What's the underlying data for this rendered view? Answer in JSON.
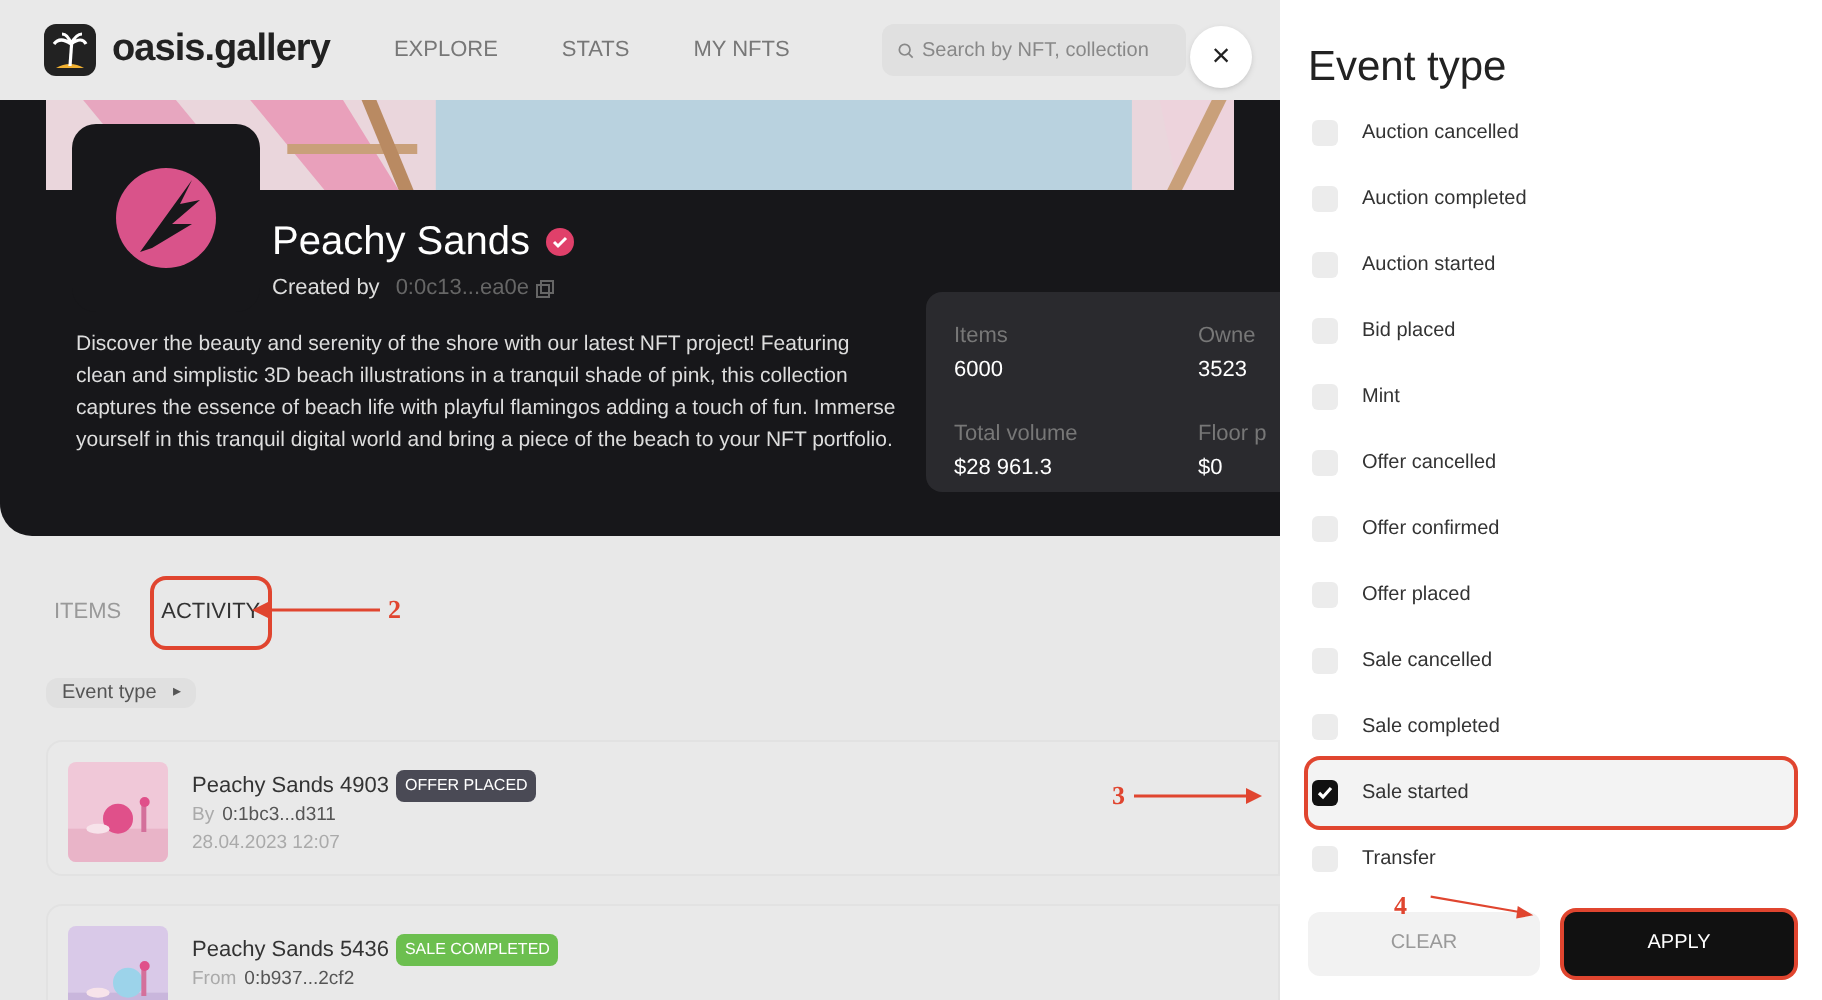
{
  "header": {
    "logo": "oasis.gallery",
    "nav": [
      {
        "label": "EXPLORE"
      },
      {
        "label": "STATS"
      },
      {
        "label": "MY NFTS"
      }
    ],
    "search": {
      "placeholder": "Search by NFT, collection"
    },
    "close": "×"
  },
  "banner": {
    "kind": "picture"
  },
  "collection": {
    "name": "Peachy Sands",
    "verified": true,
    "created_by_label": "Created by",
    "creator": "0:0c13...ea0e",
    "description": "Discover the beauty and serenity of the shore with our latest NFT project! Featuring clean and simplistic 3D beach illustrations in a tranquil shade of pink, this collection captures the essence of beach life with playful flamingos adding a touch of fun. Immerse yourself in this tranquil digital world and bring a piece of the beach to your NFT portfolio.",
    "stats": [
      {
        "label": "Items",
        "value": "6000"
      },
      {
        "label": "Owne",
        "value": "3523"
      },
      {
        "label": "Total volume",
        "value": "$28 961.3"
      },
      {
        "label": "Floor p",
        "value": "$0"
      }
    ]
  },
  "tabs": [
    {
      "label": "ITEMS",
      "selected": false,
      "highlighted": false
    },
    {
      "label": "ACTIVITY",
      "selected": true,
      "highlighted": true
    }
  ],
  "filter_button": {
    "label": "Event type",
    "arrow": "▸"
  },
  "activity": [
    {
      "title": "Peachy Sands 4903",
      "badge": "OFFER PLACED",
      "color": "#4a4a55",
      "by_label": "By",
      "address": "0:1bc3...d311",
      "date": "28.04.2023 12:07"
    },
    {
      "title": "Peachy Sands 5436",
      "badge": "SALE COMPLETED",
      "color": "#6cbf4f",
      "by_label": "From",
      "address": "0:b937...2cf2"
    }
  ],
  "drawer": {
    "title": "Event type",
    "options": [
      {
        "label": "Auction cancelled",
        "checked": false,
        "highlighted": false
      },
      {
        "label": "Auction completed",
        "checked": false,
        "highlighted": false
      },
      {
        "label": "Auction started",
        "checked": false,
        "highlighted": false
      },
      {
        "label": "Bid placed",
        "checked": false,
        "highlighted": false
      },
      {
        "label": "Mint",
        "checked": false,
        "highlighted": false
      },
      {
        "label": "Offer cancelled",
        "checked": false,
        "highlighted": false
      },
      {
        "label": "Offer confirmed",
        "checked": false,
        "highlighted": false
      },
      {
        "label": "Offer placed",
        "checked": false,
        "highlighted": false
      },
      {
        "label": "Sale cancelled",
        "checked": false,
        "highlighted": false
      },
      {
        "label": "Sale completed",
        "checked": false,
        "highlighted": false
      },
      {
        "label": "Sale started",
        "checked": true,
        "highlighted": true
      },
      {
        "label": "Transfer",
        "checked": false,
        "highlighted": false
      }
    ],
    "clear": {
      "label": "CLEAR",
      "highlighted": false
    },
    "apply": {
      "label": "APPLY",
      "highlighted": true
    }
  },
  "annotations": [
    "2",
    "3",
    "4"
  ]
}
